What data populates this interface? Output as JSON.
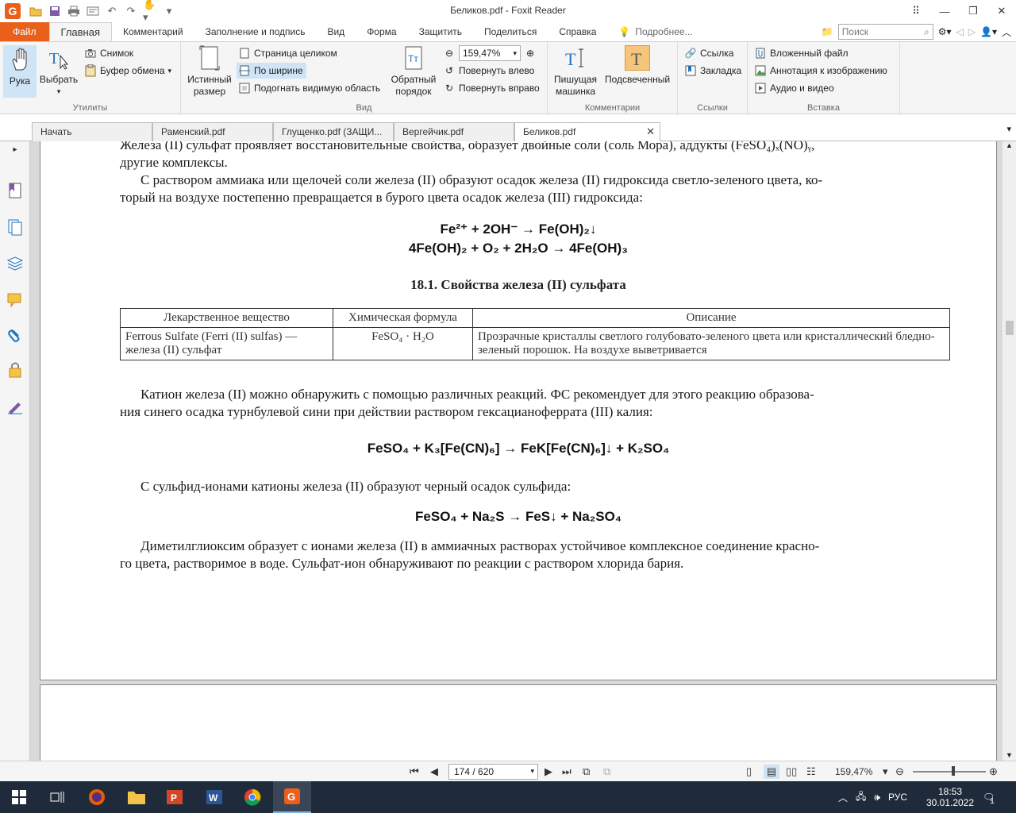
{
  "window": {
    "title": "Беликов.pdf - Foxit Reader",
    "app_logo": "G"
  },
  "ribbon_tabs": {
    "file": "Файл",
    "items": [
      "Главная",
      "Комментарий",
      "Заполнение и подпись",
      "Вид",
      "Форма",
      "Защитить",
      "Поделиться",
      "Справка"
    ],
    "tell_me": "Подробнее...",
    "search_placeholder": "Поиск"
  },
  "ribbon": {
    "groups": {
      "utilities": "Утилиты",
      "view": "Вид",
      "comments": "Комментарии",
      "links": "Ссылки",
      "insert": "Вставка"
    },
    "hand": "Рука",
    "select": "Выбрать",
    "snapshot": "Снимок",
    "clipboard": "Буфер обмена",
    "actual_size_1": "Истинный",
    "actual_size_2": "размер",
    "fit_page": "Страница целиком",
    "fit_width": "По ширине",
    "fit_visible": "Подогнать видимую область",
    "reverse_1": "Обратный",
    "reverse_2": "порядок",
    "zoom_value": "159,47%",
    "rotate_left": "Повернуть влево",
    "rotate_right": "Повернуть вправо",
    "typewriter_1": "Пишущая",
    "typewriter_2": "машинка",
    "highlight": "Подсвеченный",
    "link": "Ссылка",
    "bookmark": "Закладка",
    "attachment": "Вложенный файл",
    "image_annotation": "Аннотация к изображению",
    "audio_video": "Аудио и видео"
  },
  "doc_tabs": [
    "Начать",
    "Раменский.pdf",
    "Глущенко.pdf (ЗАЩИ...",
    "Вергейчик.pdf",
    "Беликов.pdf"
  ],
  "document": {
    "p1_line1": "Железа (II) сульфат проявляет восстановительные свойства, образует двойные соли (соль Мора), аддукты (FeSO₄)ₓ(NO)ᵧ,",
    "p1_line2": "другие комплексы.",
    "p2_line1": "С раствором аммиака или щелочей соли железа (II) образуют осадок железа (II) гидроксида светло-зеленого цвета, ко-",
    "p2_line2": "торый на воздухе постепенно превращается в бурого цвета осадок железа (III) гидроксида:",
    "formula1": "Fe²⁺ + 2OH⁻ → Fe(OH)₂↓",
    "formula2": "4Fe(OH)₂ + O₂ + 2H₂O → 4Fe(OH)₃",
    "table_caption": "18.1. Свойства железа (II) сульфата",
    "table": {
      "headers": [
        "Лекарственное вещество",
        "Химическая формула",
        "Описание"
      ],
      "rows": [
        [
          "Ferrous Sulfate (Ferri (II) sulfas) — железа (II) сульфат",
          "FeSO₄ · H₂O",
          "Прозрачные кристаллы светлого голубовато-зеленого цвета или кристаллический бледно-зеленый порошок. На воздухе выветривается"
        ]
      ]
    },
    "p3_line1": "Катион железа (II) можно обнаружить с помощью различных реакций. ФС рекомендует для этого реакцию образова-",
    "p3_line2": "ния синего осадка турнбулевой сини при действии раствором гексацианоферрата (III) калия:",
    "formula3": "FeSO₄ + K₃[Fe(CN)₆] → FeK[Fe(CN)₆]↓ + K₂SO₄",
    "p4": "С сульфид-ионами катионы железа (II) образуют черный осадок сульфида:",
    "formula4": "FeSO₄ + Na₂S → FeS↓ + Na₂SO₄",
    "p5_line1": "Диметилглиоксим образует с ионами железа (II) в аммиачных растворах устойчивое комплексное соединение красно-",
    "p5_line2": "го цвета, растворимое в воде. Сульфат-ион обнаруживают по реакции с раствором хлорида бария."
  },
  "statusbar": {
    "page_indicator": "174 / 620",
    "zoom": "159,47%"
  },
  "taskbar": {
    "language": "РУС",
    "time": "18:53",
    "date": "30.01.2022",
    "notifications": "1"
  },
  "colors": {
    "accent": "#e8601c",
    "ribbon_bg": "#f5f5f5",
    "doc_bg": "#d9d9d9",
    "taskbar_bg": "#1f2b3a",
    "highlight": "#cfe4f7"
  }
}
